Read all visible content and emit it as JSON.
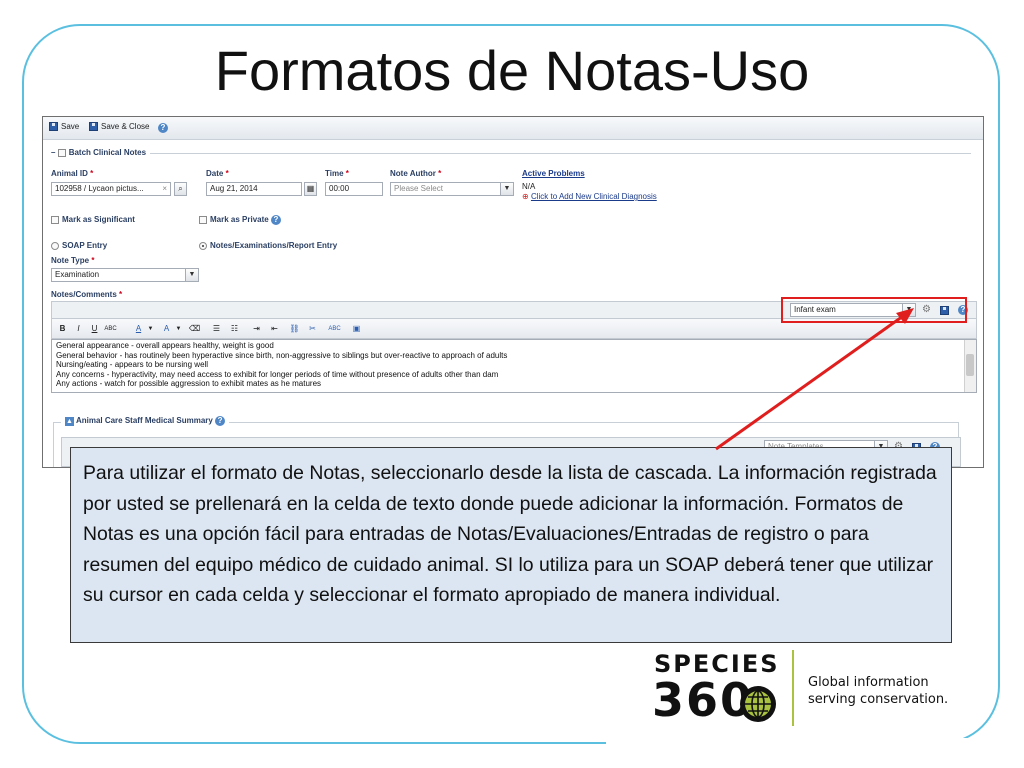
{
  "slide": {
    "title": "Formatos de Notas-Uso",
    "callout_text": "Para utilizar el formato de Notas, seleccionarlo desde la lista de cascada. La información registrada por usted se prellenará en la celda de texto donde puede adicionar la información. Formatos de Notas es una opción fácil para entradas de Notas/Evaluaciones/Entradas de registro o para resumen del equipo médico de cuidado animal.  SI lo utiliza para un SOAP deberá tener que utilizar su cursor en cada celda y seleccionar el formato apropiado de manera individual."
  },
  "colors": {
    "frame": "#5bc0e0",
    "callout_bg": "#dce6f2",
    "highlight": "#e01e1e",
    "arrow": "#e01e1e",
    "label": "#2a3f63",
    "logo_accent": "#a9c23f"
  },
  "toolbar": {
    "save_label": "Save",
    "save_close_label": "Save & Close"
  },
  "form": {
    "batch_label": "Batch Clinical Notes",
    "animal_id": {
      "label": "Animal ID",
      "value": "102958 / Lycaon pictus..."
    },
    "date": {
      "label": "Date",
      "value": "Aug 21, 2014"
    },
    "time": {
      "label": "Time",
      "value": "00:00"
    },
    "note_author": {
      "label": "Note Author",
      "placeholder": "Please Select"
    },
    "active_problems": {
      "label": "Active Problems",
      "value": "N/A",
      "add_link": "Click to Add New Clinical Diagnosis"
    },
    "mark_significant": "Mark as Significant",
    "mark_private": "Mark as Private",
    "soap_entry": "SOAP Entry",
    "notes_entry": "Notes/Examinations/Report Entry",
    "note_type": {
      "label": "Note Type",
      "value": "Examination"
    },
    "notes_comments_label": "Notes/Comments",
    "template_select": "Infant exam",
    "notes_lines": [
      "General appearance - overall appears healthy, weight is good",
      "General behavior - has routinely been hyperactive since birth, non-aggressive to siblings but over-reactive to approach of adults",
      "Nursing/eating - appears to be nursing well",
      "Any concerns - hyperactivity, may need access to exhibit for longer periods of time without presence of adults other than dam",
      "Any actions - watch for possible aggression to exhibit mates as he matures"
    ],
    "summary_label": "Animal Care Staff Medical Summary",
    "summary_template_placeholder": "Note Templates"
  },
  "logo": {
    "line1": "SPECIES",
    "line2": "360",
    "tagline1": "Global information",
    "tagline2": "serving conservation."
  }
}
